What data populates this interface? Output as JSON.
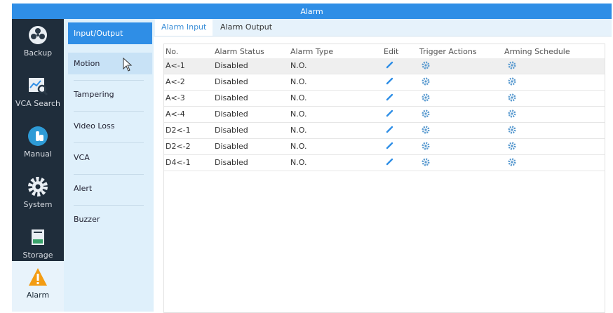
{
  "window": {
    "title": "Alarm"
  },
  "colors": {
    "titlebar": "#2f8ee6",
    "nav_bg": "#1f2d3b",
    "subnav_bg": "#dff0fb",
    "accent": "#2f8ee6",
    "alarm_icon": "#f39c12"
  },
  "left_nav": {
    "items": [
      {
        "label": "Backup",
        "icon": "backup-icon"
      },
      {
        "label": "VCA Search",
        "icon": "vca-search-icon"
      },
      {
        "label": "Manual",
        "icon": "manual-hand-icon"
      },
      {
        "label": "System",
        "icon": "gear-icon"
      },
      {
        "label": "Storage",
        "icon": "storage-icon"
      },
      {
        "label": "Alarm",
        "icon": "warning-icon"
      }
    ]
  },
  "sub_nav": {
    "items": [
      {
        "label": "Input/Output"
      },
      {
        "label": "Motion"
      },
      {
        "label": "Tampering"
      },
      {
        "label": "Video Loss"
      },
      {
        "label": "VCA"
      },
      {
        "label": "Alert"
      },
      {
        "label": "Buzzer"
      }
    ]
  },
  "tabs": [
    {
      "label": "Alarm Input"
    },
    {
      "label": "Alarm Output"
    }
  ],
  "table": {
    "headers": [
      "No.",
      "Alarm Status",
      "Alarm Type",
      "Edit",
      "Trigger Actions",
      "Arming Schedule"
    ],
    "rows": [
      {
        "no": "A<-1",
        "status": "Disabled",
        "type": "N.O."
      },
      {
        "no": "A<-2",
        "status": "Disabled",
        "type": "N.O."
      },
      {
        "no": "A<-3",
        "status": "Disabled",
        "type": "N.O."
      },
      {
        "no": "A<-4",
        "status": "Disabled",
        "type": "N.O."
      },
      {
        "no": "D2<-1",
        "status": "Disabled",
        "type": "N.O."
      },
      {
        "no": "D2<-2",
        "status": "Disabled",
        "type": "N.O."
      },
      {
        "no": "D4<-1",
        "status": "Disabled",
        "type": "N.O."
      }
    ]
  }
}
